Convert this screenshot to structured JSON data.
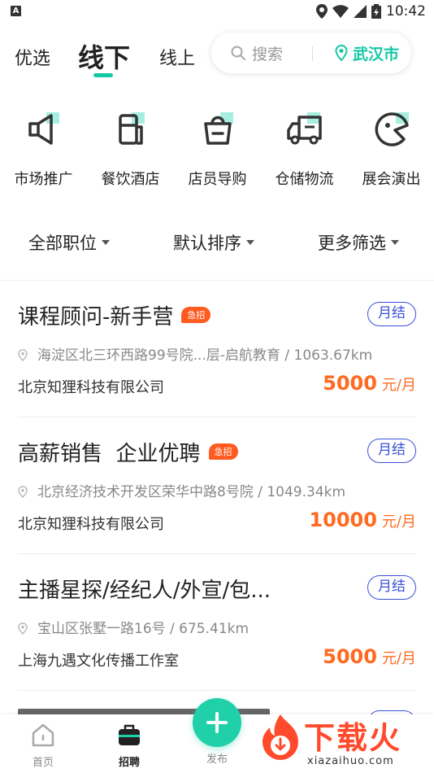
{
  "status_bar": {
    "time": "10:42",
    "left_icon": "A"
  },
  "top_tabs": [
    {
      "label": "优选",
      "active": false
    },
    {
      "label": "线下",
      "active": true
    },
    {
      "label": "线上",
      "active": false
    }
  ],
  "search": {
    "placeholder": "搜索",
    "city": "武汉市"
  },
  "categories": [
    {
      "label": "市场推广",
      "icon": "megaphone-icon"
    },
    {
      "label": "餐饮酒店",
      "icon": "cup-icon"
    },
    {
      "label": "店员导购",
      "icon": "shopping-bag-icon"
    },
    {
      "label": "仓储物流",
      "icon": "truck-icon"
    },
    {
      "label": "展会演出",
      "icon": "palette-icon"
    }
  ],
  "filters": [
    {
      "label": "全部职位"
    },
    {
      "label": "默认排序"
    },
    {
      "label": "更多筛选"
    }
  ],
  "jobs": [
    {
      "title": "课程顾问-新手营",
      "urgent": "急招",
      "settlement": "月结",
      "address": "海淀区北三环西路99号院...层-启航教育 / 1063.67km",
      "company": "北京知狸科技有限公司",
      "salary": "5000",
      "salary_unit": "元/月"
    },
    {
      "title": "高薪销售  企业优聘",
      "urgent": "急招",
      "settlement": "月结",
      "address": "北京经济技术开发区荣华中路8号院 / 1049.34km",
      "company": "北京知狸科技有限公司",
      "salary": "10000",
      "salary_unit": "元/月"
    },
    {
      "title": "主播星探/经纪人/外宣/包...",
      "urgent": "",
      "settlement": "月结",
      "address": "宝山区张墅一路16号 / 675.41km",
      "company": "上海九遇文化传播工作室",
      "salary": "5000",
      "salary_unit": "元/月"
    }
  ],
  "bottom_nav": {
    "home": "首页",
    "jobs": "招聘",
    "publish": "发布"
  },
  "watermark": {
    "text": "下载火",
    "sub": "xiazaihuo.com"
  },
  "colors": {
    "accent": "#13c8a4",
    "salary": "#ff6a21",
    "settle": "#3a50d9",
    "urgent": "#ff5a1f"
  }
}
